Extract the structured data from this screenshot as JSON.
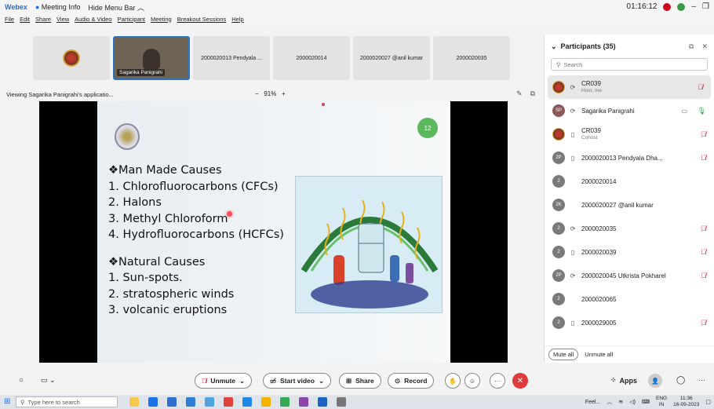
{
  "titlebar": {
    "app_name": "Webex",
    "meeting_info": "Meeting Info",
    "hide_menu": "Hide Menu Bar",
    "timer": "01:16:12",
    "menu": [
      "File",
      "Edit",
      "Share",
      "View",
      "Audio & Video",
      "Participant",
      "Meeting",
      "Breakout Sessions",
      "Help"
    ]
  },
  "thumbnails": [
    {
      "label": "",
      "type": "logo"
    },
    {
      "label": "Sagarika Panigrahi",
      "type": "video"
    },
    {
      "label": "2000020013 Pendyala ...",
      "type": "name"
    },
    {
      "label": "2000020014",
      "type": "name"
    },
    {
      "label": "2000020027 @anil kumar",
      "type": "name"
    },
    {
      "label": "2000020035",
      "type": "name"
    }
  ],
  "viewbar": {
    "viewing": "Viewing Sagarika Panigrahi's applicatio...",
    "zoom_minus": "−",
    "zoom_level": "91%",
    "zoom_plus": "+"
  },
  "slide": {
    "number": "12",
    "lines_a": [
      "❖Man Made Causes",
      "1. Chlorofluorocarbons (CFCs)",
      "2. Halons",
      "3. Methyl Chloroform",
      "4. Hydrofluorocarbons (HCFCs)"
    ],
    "lines_b": [
      "❖Natural Causes",
      "1. Sun-spots.",
      "2. stratospheric winds",
      "3. volcanic eruptions"
    ]
  },
  "participants": {
    "title": "Participants (35)",
    "search_placeholder": "Search",
    "list": [
      {
        "initials": "",
        "name": "CR039",
        "sub": "Host, me",
        "logo": true,
        "muted": true,
        "dev": "mic"
      },
      {
        "initials": "SP",
        "name": "Sagarika Panigrahi",
        "sub": "",
        "logo": false,
        "muted": false,
        "dev": "mic",
        "cam": true
      },
      {
        "initials": "",
        "name": "CR039",
        "sub": "Cohost",
        "logo": true,
        "muted": true,
        "dev": "phone"
      },
      {
        "initials": "2P",
        "name": "2000020013 Pendyala  Dha...",
        "sub": "",
        "logo": false,
        "muted": true,
        "dev": "phone"
      },
      {
        "initials": "2",
        "name": "2000020014",
        "sub": "",
        "logo": false,
        "muted": false,
        "dev": ""
      },
      {
        "initials": "2K",
        "name": "2000020027 @anil kumar",
        "sub": "",
        "logo": false,
        "muted": false,
        "dev": ""
      },
      {
        "initials": "2",
        "name": "2000020035",
        "sub": "",
        "logo": false,
        "muted": true,
        "dev": "mic"
      },
      {
        "initials": "2",
        "name": "2000020039",
        "sub": "",
        "logo": false,
        "muted": true,
        "dev": "phone"
      },
      {
        "initials": "2P",
        "name": "2000020045 Utkrista Pokharel",
        "sub": "",
        "logo": false,
        "muted": true,
        "dev": "mic"
      },
      {
        "initials": "2",
        "name": "2000020065",
        "sub": "",
        "logo": false,
        "muted": false,
        "dev": ""
      },
      {
        "initials": "2",
        "name": "2000029005",
        "sub": "",
        "logo": false,
        "muted": true,
        "dev": "phone"
      }
    ],
    "mute_all": "Mute all",
    "unmute_all": "Unmute all"
  },
  "controls": {
    "unmute": "Unmute",
    "start_video": "Start video",
    "share": "Share",
    "record": "Record",
    "apps": "Apps"
  },
  "taskbar": {
    "search_placeholder": "Type here to search",
    "feel": "Feel...",
    "lang": "ENG",
    "region": "IN",
    "time": "11:36",
    "date": "16-09-2023"
  }
}
